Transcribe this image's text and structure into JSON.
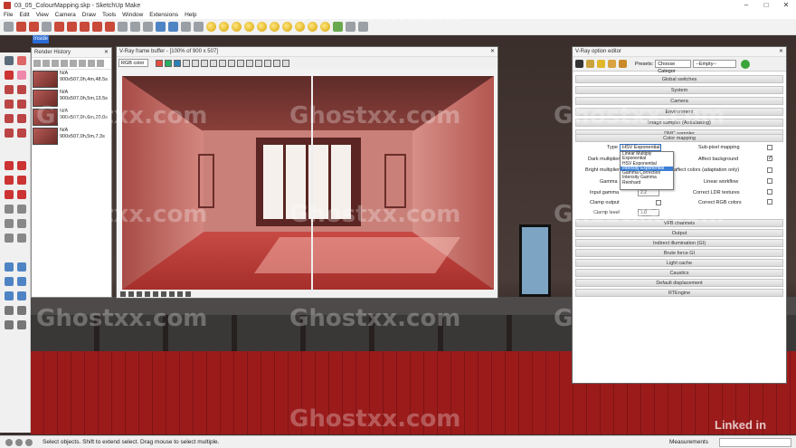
{
  "app": {
    "title": "03_05_ColourMapping.skp - SketchUp Make",
    "scene_tab": "Inside",
    "menu": [
      "File",
      "Edit",
      "View",
      "Camera",
      "Draw",
      "Tools",
      "Window",
      "Extensions",
      "Help"
    ]
  },
  "render_history": {
    "title": "Render History",
    "items": [
      {
        "name": "N/A",
        "info": "900x507,0h,4m,48.5s"
      },
      {
        "name": "N/A",
        "info": "900x507,0h,5m,13.5s"
      },
      {
        "name": "N/A",
        "info": "900x507,0h,6m,20.0s"
      },
      {
        "name": "N/A",
        "info": "900x507,0h,5m,7.3s"
      }
    ]
  },
  "frame_buffer": {
    "title": "V-Ray frame buffer - [100% of 900 x 507]",
    "channel": "RGB color"
  },
  "option_editor": {
    "title": "V-Ray option editor",
    "presets_label": "Presets:",
    "presets_category": "Choose Categor",
    "presets_value": "--Empty--",
    "rollouts_top": [
      "Global switches",
      "System",
      "Camera",
      "Environment",
      "Image sampler (Antialiasing)",
      "DMC sampler",
      "Color mapping"
    ],
    "color_mapping": {
      "type_label": "Type",
      "type_value": "HSV Exponential",
      "type_options": [
        "Linear Multiply",
        "Exponential",
        "HSV Exponential",
        "Intensity Exponential",
        "Gamma Correction",
        "Intensity Gamma",
        "Reinhard"
      ],
      "dark_multiplier_label": "Dark multiplier",
      "bright_multiplier_label": "Bright multiplier",
      "gamma_label": "Gamma",
      "input_gamma_label": "Input gamma",
      "input_gamma_value": "2.2",
      "clamp_output_label": "Clamp output",
      "clamp_level_label": "Clamp level",
      "clamp_level_value": "1.0",
      "subpixel_label": "Sub-pixel mapping",
      "affect_bg_label": "Affect background",
      "affect_colors_label": "affect colors (adaptation only)",
      "linear_workflow_label": "Linear workflow",
      "correct_ldr_label": "Correct LDR textures",
      "correct_rgb_label": "Correct RGB colors"
    },
    "rollouts_bottom": [
      "VFB channels",
      "Output",
      "Indirect illumination (GI)",
      "Brute force GI",
      "Light cache",
      "Caustics",
      "Default displacement",
      "RTEngine"
    ]
  },
  "status": {
    "hint": "Select objects. Shift to extend select. Drag mouse to select multiple.",
    "measurements_label": "Measurements"
  },
  "watermark": "Ghostxx.com",
  "brand": "Linked in"
}
